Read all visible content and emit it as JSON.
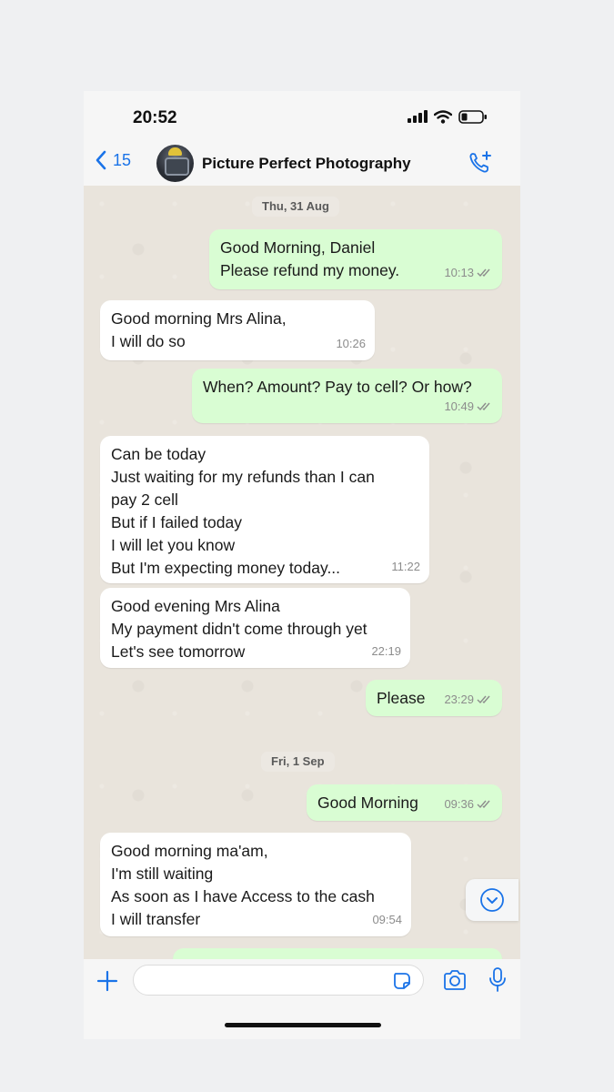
{
  "status_bar": {
    "time": "20:52"
  },
  "header": {
    "back_count": "15",
    "contact_name": "Picture Perfect Photography"
  },
  "chat": {
    "dates": [
      "Thu, 31 Aug",
      "Fri, 1 Sep"
    ],
    "messages": [
      {
        "direction": "out",
        "lines": [
          "Good Morning, Daniel",
          "Please refund my money."
        ],
        "time": "10:13"
      },
      {
        "direction": "in",
        "lines": [
          "Good morning Mrs Alina,",
          "I will do so"
        ],
        "time": "10:26"
      },
      {
        "direction": "out",
        "lines": [
          "When? Amount? Pay to cell? Or how?"
        ],
        "time": "10:49"
      },
      {
        "direction": "in",
        "lines": [
          "Can be today",
          "Just waiting for my refunds than I can",
          "pay 2 cell",
          "But if I failed today",
          "I will let you know",
          "But I'm expecting money today..."
        ],
        "time": "11:22"
      },
      {
        "direction": "in",
        "lines": [
          "Good evening Mrs Alina",
          "My payment didn't come through yet",
          "Let's see tomorrow"
        ],
        "time": "22:19"
      },
      {
        "direction": "out",
        "lines": [
          "Please"
        ],
        "time": "23:29"
      },
      {
        "direction": "out",
        "lines": [
          "Good Morning"
        ],
        "time": "09:36"
      },
      {
        "direction": "in",
        "lines": [
          "Good morning ma'am,",
          "I'm still waiting",
          "As soon as I have Access to the cash",
          "I will transfer"
        ],
        "time": "09:54"
      }
    ]
  },
  "input_bar": {
    "placeholder": ""
  },
  "colors": {
    "accent": "#1a73e8",
    "outgoing_bubble": "#d9fdd3",
    "incoming_bubble": "#ffffff",
    "chat_background": "#e9e4dc"
  },
  "icons": {
    "back": "chevron-left-icon",
    "call": "phone-plus-icon",
    "scroll": "chevron-down-circle-icon",
    "plus": "plus-icon",
    "sticker": "sticker-icon",
    "camera": "camera-icon",
    "mic": "microphone-icon"
  }
}
